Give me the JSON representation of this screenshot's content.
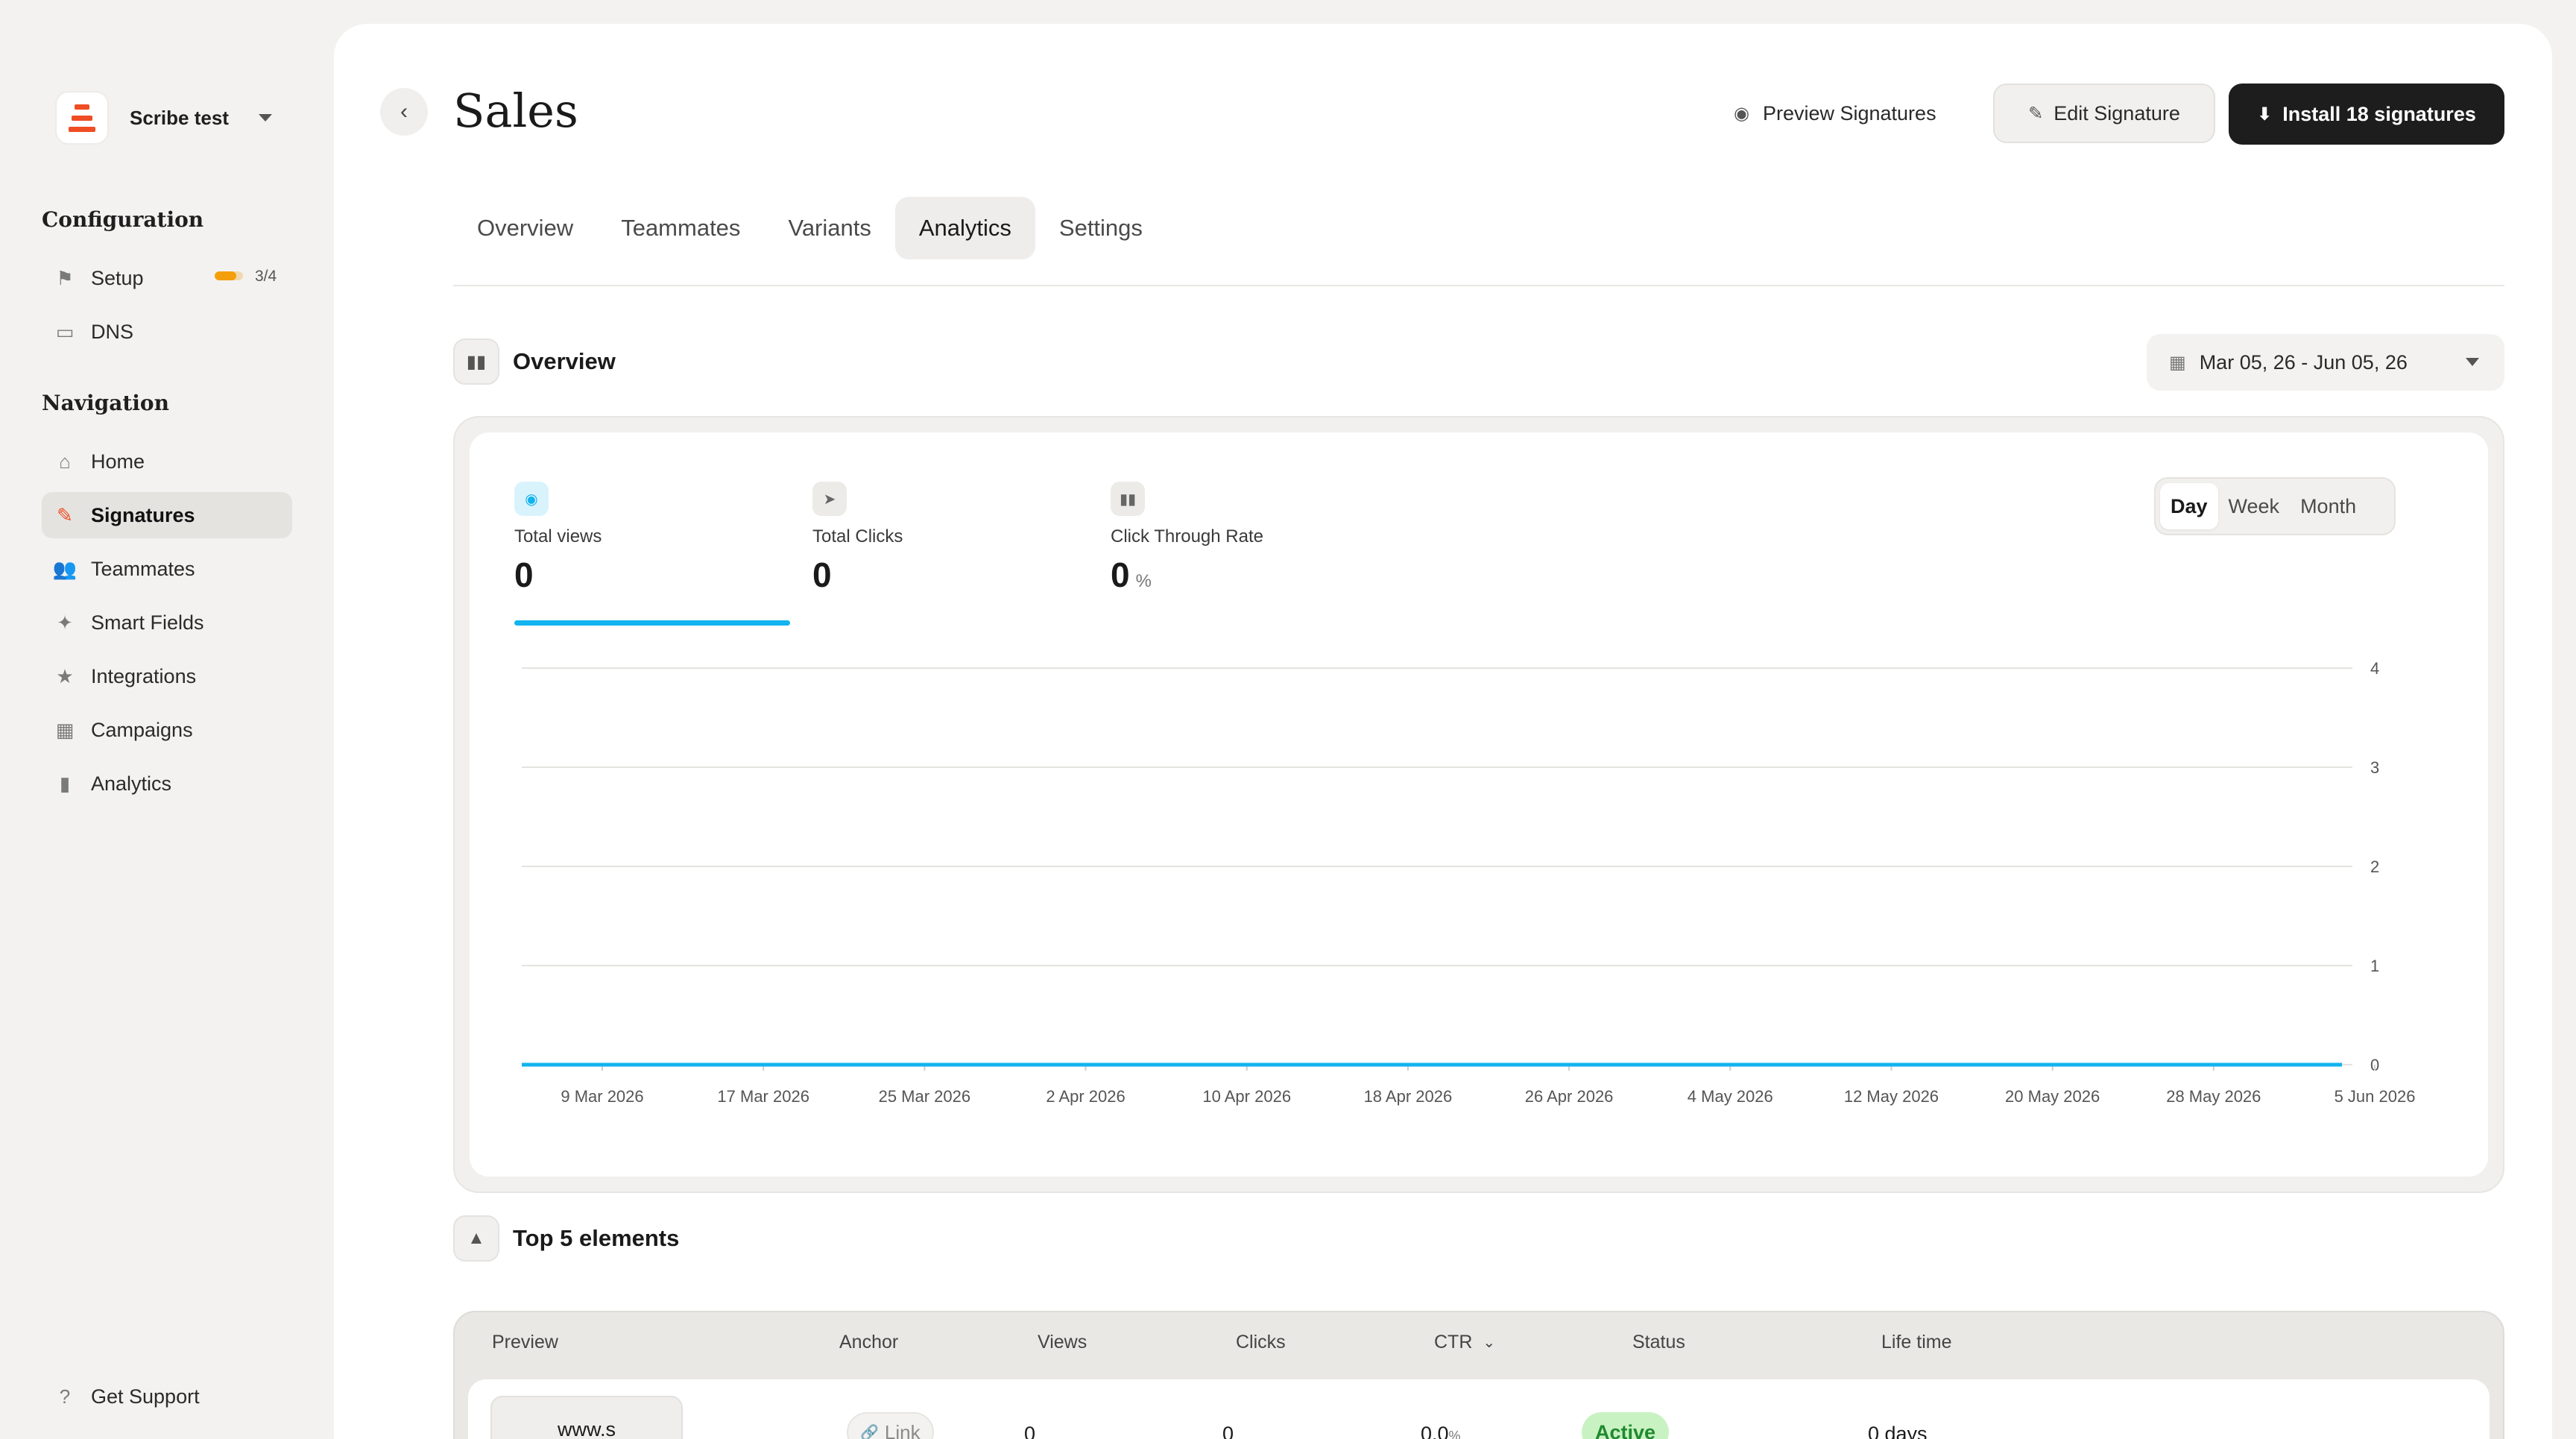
{
  "workspace": {
    "name": "Scribe test"
  },
  "sidebar": {
    "config_title": "Configuration",
    "config_items": [
      {
        "label": "Setup",
        "progress_text": "3/4",
        "progress": 0.75
      },
      {
        "label": "DNS"
      }
    ],
    "nav_title": "Navigation",
    "nav_items": [
      {
        "label": "Home"
      },
      {
        "label": "Signatures"
      },
      {
        "label": "Teammates"
      },
      {
        "label": "Smart Fields"
      },
      {
        "label": "Integrations"
      },
      {
        "label": "Campaigns"
      },
      {
        "label": "Analytics"
      }
    ],
    "support_label": "Get Support"
  },
  "header": {
    "title": "Sales",
    "preview_label": "Preview Signatures",
    "edit_label": "Edit Signature",
    "install_label": "Install 18 signatures"
  },
  "tabs": [
    "Overview",
    "Teammates",
    "Variants",
    "Analytics",
    "Settings"
  ],
  "overview": {
    "title": "Overview",
    "date_range": "Mar 05, 26 - Jun 05, 26",
    "metrics": [
      {
        "label": "Total views",
        "value": "0",
        "unit": ""
      },
      {
        "label": "Total Clicks",
        "value": "0",
        "unit": ""
      },
      {
        "label": "Click Through Rate",
        "value": "0",
        "unit": "%"
      }
    ],
    "granularity": [
      "Day",
      "Week",
      "Month"
    ]
  },
  "chart_data": {
    "type": "line",
    "x": [
      "9 Mar 2026",
      "17 Mar 2026",
      "25 Mar 2026",
      "2 Apr 2026",
      "10 Apr 2026",
      "18 Apr 2026",
      "26 Apr 2026",
      "4 May 2026",
      "12 May 2026",
      "20 May 2026",
      "28 May 2026",
      "5 Jun 2026"
    ],
    "series": [
      {
        "values": [
          0,
          0,
          0,
          0,
          0,
          0,
          0,
          0,
          0,
          0,
          0,
          0
        ]
      }
    ],
    "yticks": [
      0,
      1,
      2,
      3,
      4
    ],
    "ylim": [
      0,
      4
    ],
    "line_color": "#12b3ee",
    "grid": true,
    "y_axis_side": "right"
  },
  "top_elements": {
    "title": "Top 5 elements",
    "columns": [
      "Preview",
      "Anchor",
      "Views",
      "Clicks",
      "CTR",
      "Status",
      "Life time"
    ],
    "rows": [
      {
        "preview": "www.s",
        "anchor": "Link",
        "views": "0",
        "clicks": "0",
        "ctr": "0.0",
        "ctr_unit": "%",
        "status": "Active",
        "lifetime": "0 days"
      }
    ]
  },
  "colors": {
    "accent": "#ef4d23",
    "chart_line": "#12b3ee",
    "active_status": "#1f8a2e"
  }
}
